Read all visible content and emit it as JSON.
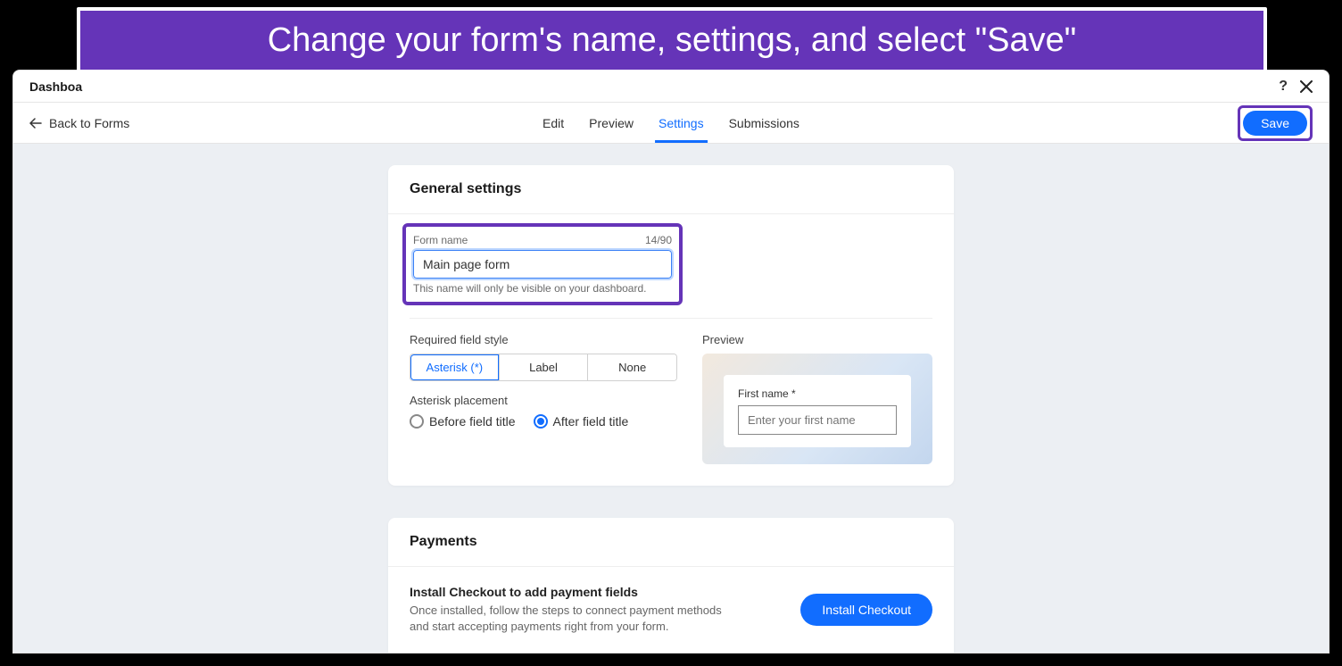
{
  "callout": "Change your form's name, settings, and select \"Save\"",
  "titlebar": {
    "title": "Dashboa"
  },
  "toolbar": {
    "back_label": "Back to Forms",
    "save_label": "Save"
  },
  "tabs": {
    "edit": "Edit",
    "preview": "Preview",
    "settings": "Settings",
    "submissions": "Submissions"
  },
  "general": {
    "heading": "General settings",
    "form_name_label": "Form name",
    "form_name_counter": "14/90",
    "form_name_value": "Main page form",
    "helper": "This name will only be visible on your dashboard.",
    "required_style_label": "Required field style",
    "style_asterisk": "Asterisk (*)",
    "style_label": "Label",
    "style_none": "None",
    "asterisk_placement_label": "Asterisk placement",
    "placement_before": "Before field title",
    "placement_after": "After field title",
    "preview_label": "Preview",
    "preview_field_label": "First name *",
    "preview_placeholder": "Enter your first name"
  },
  "payments": {
    "heading": "Payments",
    "title": "Install Checkout to add payment fields",
    "desc": "Once installed, follow the steps to connect payment methods and start accepting payments right from your form.",
    "button": "Install Checkout"
  }
}
